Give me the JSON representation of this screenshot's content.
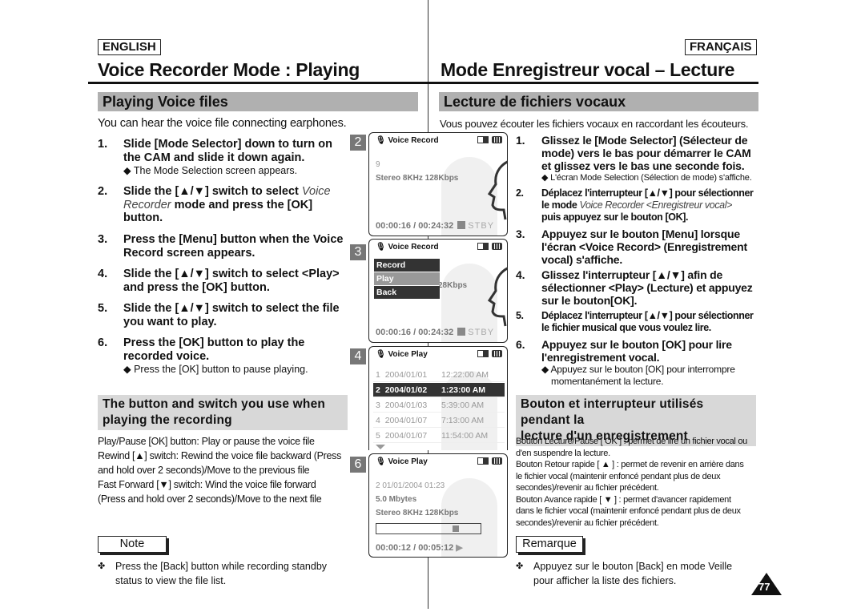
{
  "lang": {
    "en": "ENGLISH",
    "fr": "FRANÇAIS"
  },
  "en": {
    "title": "Voice Recorder Mode : Playing",
    "section": "Playing Voice files",
    "intro": "You can hear the voice file connecting earphones.",
    "steps": [
      {
        "num": "1.",
        "lines": [
          "Slide [Mode Selector] down to turn on",
          "the CAM and slide it down again."
        ],
        "sub": "◆ The Mode Selection screen appears."
      },
      {
        "num": "2.",
        "line1_pre": "Slide the [▲/▼] switch to select ",
        "line1_it": "Voice",
        "line2_it": "Recorder",
        "line2_post": " mode and press the [OK]",
        "line3": "button."
      },
      {
        "num": "3.",
        "lines": [
          "Press the [Menu] button when the Voice",
          "Record screen appears."
        ]
      },
      {
        "num": "4.",
        "lines": [
          "Slide the [▲/▼] switch to select <Play>",
          "and press the [OK] button."
        ]
      },
      {
        "num": "5.",
        "lines": [
          "Slide the [▲/▼] switch to select the file",
          "you want to play."
        ]
      },
      {
        "num": "6.",
        "lines": [
          "Press the [OK] button to play the",
          "recorded voice."
        ],
        "sub": "◆ Press the [OK] button to pause playing."
      }
    ],
    "buttons_heading": [
      "The button and switch you use when",
      "playing the recording"
    ],
    "buttons_desc": [
      "Play/Pause [OK] button: Play or pause the voice file",
      "Rewind [▲] switch: Rewind the voice file backward (Press",
      "and hold over 2 seconds)/Move to the previous file",
      "Fast Forward [▼] switch: Wind the voice file forward",
      "(Press and hold over 2 seconds)/Move to the next file"
    ],
    "note_label": "Note",
    "note_bullet": "✤",
    "note": [
      "Press the [Back] button while recording standby",
      "status to view the file list."
    ]
  },
  "fr": {
    "title": "Mode Enregistreur vocal – Lecture",
    "section": "Lecture de fichiers vocaux",
    "intro": "Vous pouvez écouter les fichiers vocaux en raccordant les écouteurs.",
    "steps": [
      {
        "num": "1.",
        "lines": [
          "Glissez le [Mode Selector] (Sélecteur de",
          "mode) vers le bas pour démarrer le CAM",
          "et glissez vers le bas une seconde fois."
        ],
        "sub": "◆ L'écran Mode Selection (Sélection de mode) s'affiche."
      },
      {
        "num": "2.",
        "line1": "Déplacez l'interrupteur [▲/▼] pour sélectionner",
        "line2_pre": "le mode ",
        "line2_it": "Voice Recorder <Enregistreur vocal>",
        "line3": "puis appuyez sur le bouton [OK]."
      },
      {
        "num": "3.",
        "lines": [
          "Appuyez sur le bouton [Menu] lorsque",
          "l'écran <Voice Record> (Enregistrement",
          "vocal) s'affiche."
        ]
      },
      {
        "num": "4.",
        "lines": [
          "Glissez l'interrupteur [▲/▼] afin de",
          "sélectionner <Play> (Lecture) et appuyez",
          "sur le bouton[OK]."
        ]
      },
      {
        "num": "5.",
        "lines": [
          "Déplacez l'interrupteur [▲/▼] pour sélectionner",
          "le fichier musical que vous voulez lire."
        ]
      },
      {
        "num": "6.",
        "lines": [
          "Appuyez sur le bouton [OK] pour lire",
          "l'enregistrement vocal."
        ],
        "sub": [
          "◆ Appuyez sur le bouton [OK] pour interrompre",
          "momentanément la lecture."
        ]
      }
    ],
    "buttons_heading": [
      "Bouton et interrupteur utilisés pendant la",
      "lecture d'un enregistrement"
    ],
    "buttons_desc": [
      "Bouton Lecture/Pause [ OK ] : permet de lire un fichier vocal ou",
      "d'en suspendre la lecture.",
      "Bouton Retour rapide [ ▲ ] : permet de revenir en arrière dans",
      "le fichier vocal (maintenir enfoncé pendant plus de deux",
      "secondes)/revenir au fichier précédent.",
      "Bouton Avance rapide [ ▼ ] : permet d'avancer rapidement",
      "dans le fichier vocal (maintenir enfoncé pendant plus de deux",
      "secondes)/revenir au fichier précédent."
    ],
    "note_label": "Remarque",
    "note_bullet": "✤",
    "note": [
      "Appuyez sur le bouton [Back] en mode Veille",
      "pour afficher la liste des fichiers."
    ]
  },
  "screens": [
    {
      "num": "2",
      "title": "Voice Record",
      "mic_icon": "🎙",
      "lines": [
        "9",
        "Stereo  8KHz  128Kbps"
      ],
      "time": "00:00:16 / 00:24:32",
      "status": "STBY"
    },
    {
      "num": "3",
      "title": "Voice Record",
      "menu": [
        "Record",
        "Play",
        "Back"
      ],
      "selected": "Play",
      "partial": "28Kbps",
      "time": "00:00:16 / 00:24:32",
      "status": "STBY"
    },
    {
      "num": "4",
      "title": "Voice Play",
      "rows": [
        {
          "idx": "1",
          "date": "2004/01/01",
          "time": "12:22:00 AM"
        },
        {
          "idx": "2",
          "date": "2004/01/02",
          "time": "1:23:00 AM",
          "selected": true
        },
        {
          "idx": "3",
          "date": "2004/01/03",
          "time": "5:39:00 AM"
        },
        {
          "idx": "4",
          "date": "2004/01/07",
          "time": "7:13:00 AM"
        },
        {
          "idx": "5",
          "date": "2004/01/07",
          "time": "11:54:00 AM"
        }
      ]
    },
    {
      "num": "6",
      "title": "Voice Play",
      "lines": [
        "2  01/01/2004  01:23",
        "5.0 Mbytes",
        "Stereo  8KHz  128Kbps"
      ],
      "progress": 0.78,
      "time": "00:00:12 / 00:05:12",
      "play_icon": "▶"
    }
  ],
  "page_number": "77"
}
